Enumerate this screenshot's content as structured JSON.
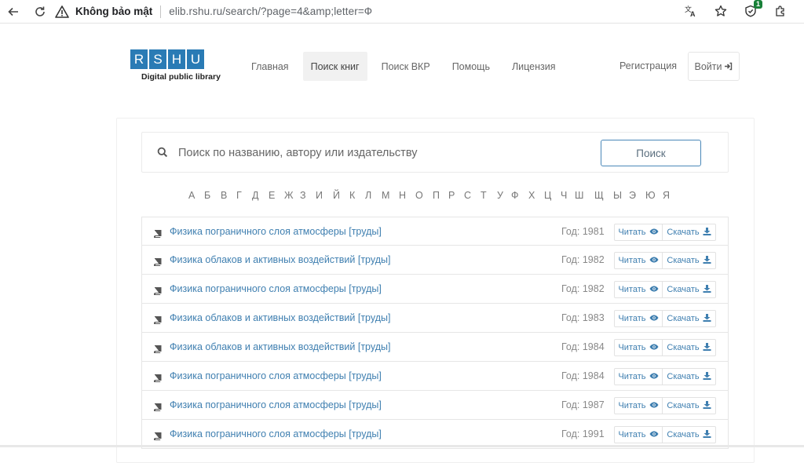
{
  "browser": {
    "not_secure_label": "Không bảo mật",
    "url": "elib.rshu.ru/search/?page=4&amp;letter=Ф",
    "extension_badge": "1"
  },
  "logo": {
    "letters": [
      "R",
      "S",
      "H",
      "U"
    ],
    "subtitle": "Digital public library"
  },
  "nav": {
    "items": [
      {
        "label": "Главная",
        "active": false
      },
      {
        "label": "Поиск книг",
        "active": true
      },
      {
        "label": "Поиск ВКР",
        "active": false
      },
      {
        "label": "Помощь",
        "active": false
      },
      {
        "label": "Лицензия",
        "active": false
      }
    ],
    "register_label": "Регистрация",
    "login_label": "Войти"
  },
  "search": {
    "placeholder": "Поиск по названию, автору или издательству",
    "button_label": "Поиск"
  },
  "alphabet": [
    "А",
    "Б",
    "В",
    "Г",
    "Д",
    "Е",
    "Ж",
    "З",
    "И",
    "Й",
    "К",
    "Л",
    "М",
    "Н",
    "О",
    "П",
    "Р",
    "С",
    "Т",
    "У",
    "Ф",
    "Х",
    "Ц",
    "Ч",
    "Ш",
    "Щ",
    "Ы",
    "Э",
    "Ю",
    "Я"
  ],
  "books": {
    "read_label": "Читать",
    "download_label": "Скачать",
    "items": [
      {
        "title": "Физика пограничного слоя атмосферы [труды]",
        "year": "Год: 1981"
      },
      {
        "title": "Физика облаков и активных воздействий [труды]",
        "year": "Год: 1982"
      },
      {
        "title": "Физика пограничного слоя атмосферы [труды]",
        "year": "Год: 1982"
      },
      {
        "title": "Физика облаков и активных воздействий [труды]",
        "year": "Год: 1983"
      },
      {
        "title": "Физика облаков и активных воздействий [труды]",
        "year": "Год: 1984"
      },
      {
        "title": "Физика пограничного слоя атмосферы [труды]",
        "year": "Год: 1984"
      },
      {
        "title": "Физика пограничного слоя атмосферы [труды]",
        "year": "Год: 1987"
      },
      {
        "title": "Физика пограничного слоя атмосферы [труды]",
        "year": "Год: 1991"
      }
    ]
  },
  "colors": {
    "brand": "#2a7bb5",
    "link": "#3f7fb0",
    "search_border": "#4a88b8"
  }
}
